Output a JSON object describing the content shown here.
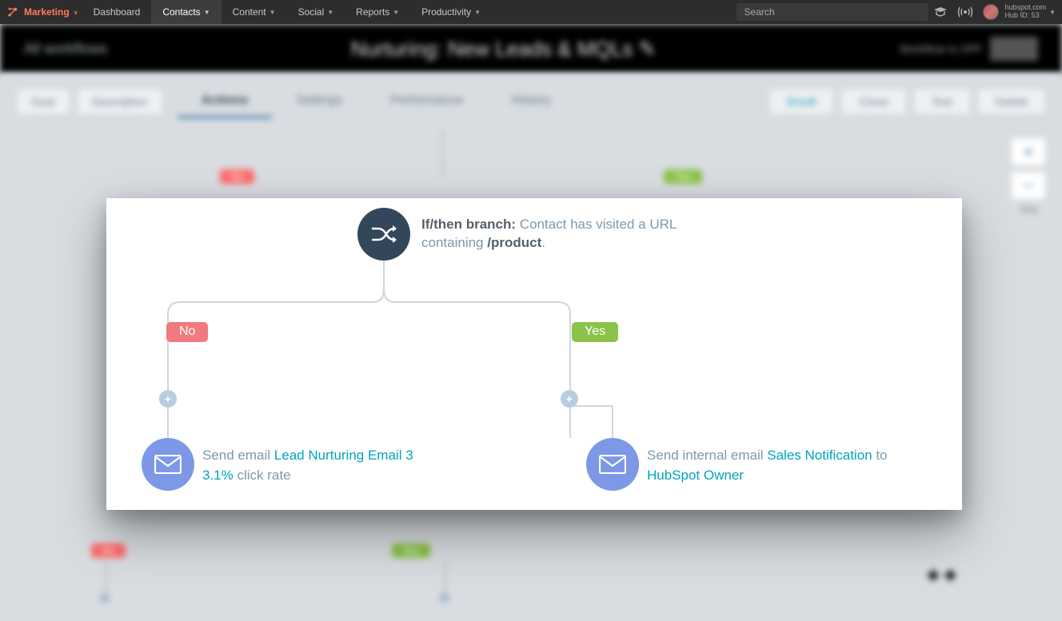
{
  "nav": {
    "brand": "Marketing",
    "items": [
      "Dashboard",
      "Contacts",
      "Content",
      "Social",
      "Reports",
      "Productivity"
    ],
    "selected": "Contacts",
    "search_placeholder": "Search",
    "hub_domain": "hubspot.com",
    "hub_id_label": "Hub ID: 53"
  },
  "header": {
    "breadcrumb": "All workflows",
    "title": "Nurturing: New Leads & MQLs",
    "status": "Workflow is OFF"
  },
  "toolbar": {
    "goal": "Goal",
    "description": "Description",
    "tabs": [
      "Actions",
      "Settings",
      "Performance",
      "History"
    ],
    "active_tab": "Actions",
    "enroll": "Enroll",
    "clone": "Clone",
    "test": "Test",
    "delete": "Delete"
  },
  "zoom": {
    "level": "70%"
  },
  "branch": {
    "label": "If/then branch:",
    "condition_prefix": "Contact has visited a URL containing ",
    "condition_value": "/product",
    "yes": "Yes",
    "no": "No"
  },
  "left_action": {
    "prefix": "Send email ",
    "email_name": "Lead Nurturing Email 3",
    "metric_value": "3.1%",
    "metric_label": " click rate"
  },
  "right_action": {
    "prefix": "Send internal email ",
    "email_name": "Sales Notification",
    "mid": " to ",
    "recipient": "HubSpot Owner"
  }
}
